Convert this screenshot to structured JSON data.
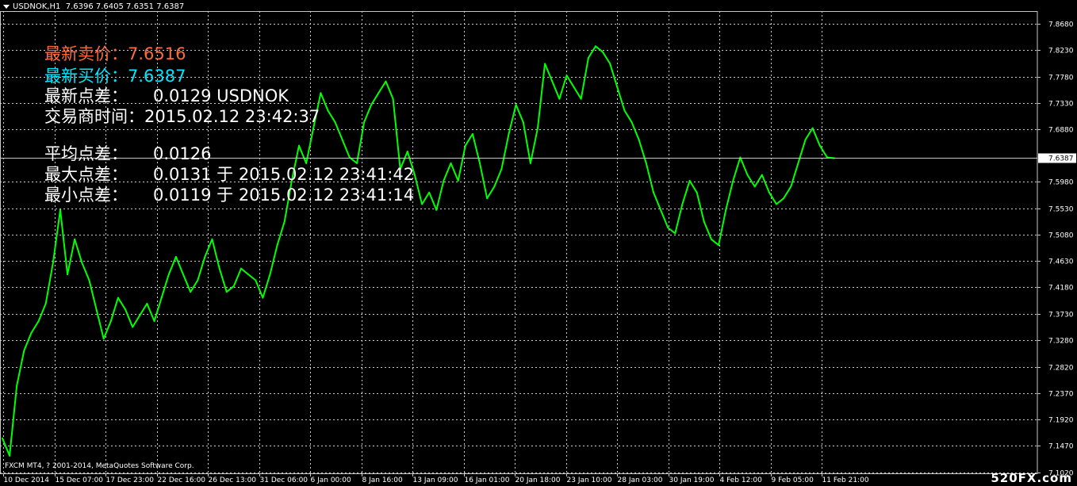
{
  "header": {
    "symbol": "USDNOK,H1",
    "ohlc": "7.6396 7.6405 7.6351 7.6387"
  },
  "overlay": {
    "ask_label": "最新卖价：",
    "ask_value": "7.6516",
    "bid_label": "最新买价：",
    "bid_value": "7.6387",
    "spread_label": "最新点差：",
    "spread_value": "0.0129 USDNOK",
    "broker_time_label": "交易商时间：",
    "broker_time_value": "2015.02.12 23:42:37",
    "avg_label": "平均点差：",
    "avg_value": "0.0126",
    "max_label": "最大点差：",
    "max_value": "0.0131 于 2015.02.12 23:41:42",
    "min_label": "最小点差：",
    "min_value": "0.0119 于 2015.02.12 23:41:14"
  },
  "colors": {
    "background": "#000000",
    "grid": "#c8c8c8",
    "price_line": "#00ff00",
    "ask": "#ff6a3d",
    "bid": "#00e6ff",
    "text": "#ffffff"
  },
  "footer": {
    "copyright": "FXCM MT4, ? 2001-2014, MetaQuotes Software Corp.",
    "watermark": "520FX.com"
  },
  "chart_data": {
    "type": "line",
    "grid": true,
    "y_tick_labels": [
      "7.8680",
      "7.8230",
      "7.7780",
      "7.7330",
      "7.6880",
      "7.6387",
      "7.5980",
      "7.5530",
      "7.5080",
      "7.4630",
      "7.4180",
      "7.3730",
      "7.3280",
      "7.2820",
      "7.2370",
      "7.1920",
      "7.1470",
      "7.1020"
    ],
    "y_ticks": [
      7.868,
      7.823,
      7.778,
      7.733,
      7.688,
      7.643,
      7.598,
      7.553,
      7.508,
      7.463,
      7.418,
      7.373,
      7.328,
      7.282,
      7.237,
      7.192,
      7.147,
      7.102
    ],
    "ylim": [
      7.1,
      7.89
    ],
    "current_price": 7.6387,
    "current_price_label": "7.6387",
    "x_tick_labels": [
      "10 Dec 2014",
      "15 Dec 07:00",
      "17 Dec 23:00",
      "22 Dec 16:00",
      "26 Dec 13:00",
      "31 Dec 06:00",
      "6 Jan 00:00",
      "8 Jan 16:00",
      "13 Jan 09:00",
      "16 Jan 01:00",
      "20 Jan 18:00",
      "23 Jan 10:00",
      "28 Jan 03:00",
      "30 Jan 19:00",
      "4 Feb 12:00",
      "9 Feb 05:00",
      "11 Feb 21:00"
    ],
    "series": [
      {
        "values": [
          7.16,
          7.13,
          7.25,
          7.31,
          7.34,
          7.36,
          7.39,
          7.46,
          7.55,
          7.44,
          7.5,
          7.46,
          7.43,
          7.38,
          7.33,
          7.36,
          7.4,
          7.38,
          7.35,
          7.37,
          7.39,
          7.36,
          7.4,
          7.44,
          7.47,
          7.44,
          7.41,
          7.43,
          7.47,
          7.5,
          7.45,
          7.41,
          7.42,
          7.45,
          7.44,
          7.43,
          7.4,
          7.44,
          7.49,
          7.53,
          7.6,
          7.66,
          7.63,
          7.69,
          7.75,
          7.72,
          7.7,
          7.67,
          7.64,
          7.63,
          7.7,
          7.73,
          7.75,
          7.77,
          7.74,
          7.62,
          7.65,
          7.61,
          7.56,
          7.58,
          7.55,
          7.6,
          7.63,
          7.6,
          7.66,
          7.68,
          7.63,
          7.57,
          7.59,
          7.62,
          7.68,
          7.73,
          7.7,
          7.63,
          7.69,
          7.8,
          7.77,
          7.74,
          7.78,
          7.76,
          7.74,
          7.81,
          7.83,
          7.82,
          7.8,
          7.76,
          7.72,
          7.7,
          7.67,
          7.63,
          7.58,
          7.55,
          7.52,
          7.51,
          7.56,
          7.6,
          7.58,
          7.53,
          7.5,
          7.49,
          7.55,
          7.6,
          7.64,
          7.61,
          7.59,
          7.61,
          7.58,
          7.56,
          7.57,
          7.59,
          7.63,
          7.67,
          7.69,
          7.66,
          7.64,
          7.6387
        ]
      }
    ]
  }
}
